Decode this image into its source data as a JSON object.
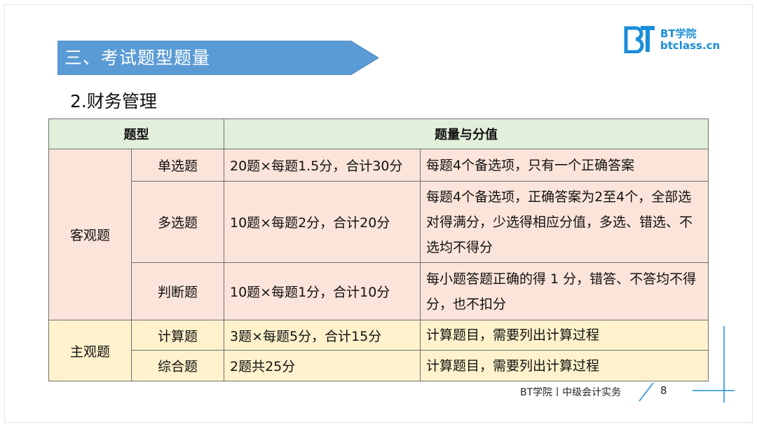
{
  "section": {
    "title": "三、考试题型题量"
  },
  "logo": {
    "line1": "BT学院",
    "line2": "btclass.cn"
  },
  "subtitle": "2.财务管理",
  "table": {
    "headers": [
      "题型",
      "题量与分值"
    ],
    "groups": [
      {
        "name": "客观题",
        "rows": [
          {
            "type": "单选题",
            "score": "20题×每题1.5分，合计30分",
            "note": "每题4个备选项，只有一个正确答案"
          },
          {
            "type": "多选题",
            "score": "10题×每题2分，合计20分",
            "note": "每题4个备选项，正确答案为2至4个，全部选对得满分，少选得相应分值，多选、错选、不选均不得分"
          },
          {
            "type": "判断题",
            "score": "10题×每题1分，合计10分",
            "note": "每小题答题正确的得 1 分，错答、不答均不得分，也不扣分"
          }
        ]
      },
      {
        "name": "主观题",
        "rows": [
          {
            "type": "计算题",
            "score": "3题×每题5分，合计15分",
            "note": "计算题目，需要列出计算过程"
          },
          {
            "type": "综合题",
            "score": "2题共25分",
            "note": "计算题目，需要列出计算过程"
          }
        ]
      }
    ]
  },
  "footer": {
    "text": "BT学院丨中级会计实务",
    "page": "8"
  },
  "colors": {
    "banner": "#5b9bd5",
    "header_bg": "#e2efda",
    "objective_bg": "#fbe4d9",
    "subjective_bg": "#fff2cc",
    "accent": "#1a8ed8"
  }
}
